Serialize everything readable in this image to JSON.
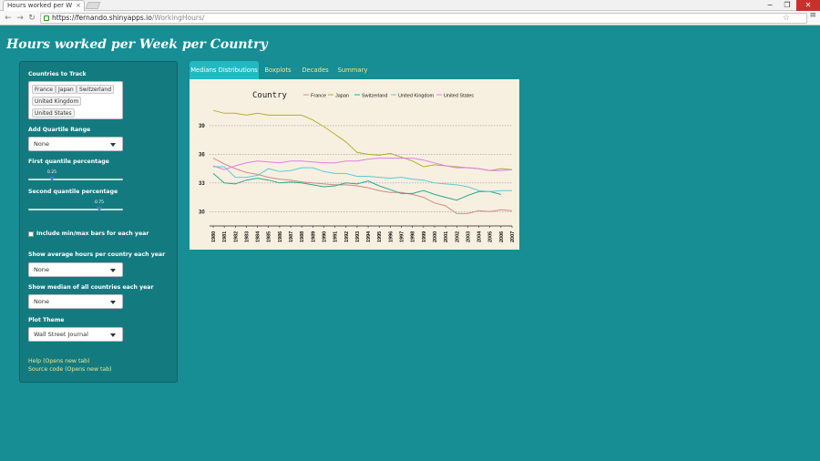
{
  "browser": {
    "tab_title": "Hours worked per W",
    "tab_close": "×",
    "url_host": "https://fernando.shinyapps.io",
    "url_path": "/WorkingHours/",
    "back_glyph": "←",
    "forward_glyph": "→",
    "reload_glyph": "↻",
    "star_glyph": "☆",
    "menu_glyph": "≡",
    "min_glyph": "−",
    "max_glyph": "❐",
    "close_glyph": "✕"
  },
  "app": {
    "title": "Hours worked per Week per Country"
  },
  "sidebar": {
    "countries_label": "Countries to Track",
    "countries": [
      "France",
      "Japan",
      "Switzerland",
      "United Kingdom",
      "United States"
    ],
    "quartile_label": "Add Quartile Range",
    "quartile_value": "None",
    "first_quartile_label": "First quantile percentage",
    "first_quartile_value": 0.25,
    "first_quartile_text": "0.25",
    "second_quartile_label": "Second quantile percentage",
    "second_quartile_value": 0.75,
    "second_quartile_text": "0.75",
    "minmax_label": "Include min/max bars for each year",
    "minmax_checked": false,
    "average_label": "Show average hours per country each year",
    "average_value": "None",
    "median_label": "Show median of all countries each year",
    "median_value": "None",
    "theme_label": "Plot Theme",
    "theme_value": "Wall Street Journal",
    "help_link": "Help (Opens new tab)",
    "source_link": "Source code (Opens new tab)"
  },
  "tabs": [
    {
      "label": "Medians Distributions",
      "active": true
    },
    {
      "label": "Boxplots",
      "active": false
    },
    {
      "label": "Decades",
      "active": false
    },
    {
      "label": "Summary",
      "active": false
    }
  ],
  "chart_data": {
    "type": "line",
    "legend_title": "Country",
    "legend_position": "top",
    "grid": true,
    "ylim": [
      28.5,
      41
    ],
    "yticks": [
      30,
      33,
      36,
      39
    ],
    "ytick_labels": [
      "30",
      "33",
      "36",
      "39"
    ],
    "x": [
      1980,
      1981,
      1982,
      1983,
      1984,
      1985,
      1986,
      1987,
      1988,
      1989,
      1990,
      1991,
      1992,
      1993,
      1994,
      1995,
      1996,
      1997,
      1998,
      1999,
      2000,
      2001,
      2002,
      2003,
      2004,
      2005,
      2006,
      2007
    ],
    "xtick_labels": [
      "1980",
      "1981",
      "1982",
      "1983",
      "1984",
      "1985",
      "1986",
      "1987",
      "1988",
      "1989",
      "1990",
      "1991",
      "1992",
      "1993",
      "1994",
      "1995",
      "1996",
      "1997",
      "1998",
      "1999",
      "2000",
      "2001",
      "2002",
      "2003",
      "2004",
      "2005",
      "2006",
      "2007"
    ],
    "series": [
      {
        "name": "France",
        "color": "#d08a86",
        "values": [
          35.6,
          35.0,
          34.5,
          34.1,
          33.9,
          33.6,
          33.4,
          33.3,
          33.1,
          33.0,
          32.9,
          32.8,
          32.8,
          32.7,
          32.5,
          32.2,
          32.0,
          32.0,
          31.8,
          31.5,
          30.9,
          30.6,
          29.8,
          29.8,
          30.1,
          30.0,
          30.2,
          30.1
        ]
      },
      {
        "name": "Japan",
        "color": "#b7ac2c",
        "values": [
          40.6,
          40.3,
          40.3,
          40.1,
          40.3,
          40.1,
          40.1,
          40.1,
          40.1,
          39.6,
          38.9,
          38.1,
          37.3,
          36.2,
          36.0,
          35.9,
          36.1,
          35.7,
          35.3,
          34.7,
          34.9,
          34.8,
          34.7,
          34.6,
          34.5,
          34.3,
          34.5,
          34.4
        ]
      },
      {
        "name": "Switzerland",
        "color": "#2ba98f",
        "values": [
          34.0,
          33.0,
          32.9,
          33.3,
          33.5,
          33.3,
          33.0,
          33.1,
          33.0,
          32.8,
          32.6,
          32.7,
          33.0,
          32.9,
          33.2,
          32.7,
          32.3,
          31.9,
          31.9,
          32.2,
          31.8,
          31.5,
          31.2,
          31.7,
          32.1,
          32.1,
          31.8,
          null
        ]
      },
      {
        "name": "United Kingdom",
        "color": "#5ec9d6",
        "values": [
          34.7,
          34.7,
          33.6,
          33.6,
          33.8,
          34.5,
          34.2,
          34.3,
          34.6,
          34.6,
          34.2,
          34.0,
          34.0,
          33.7,
          33.7,
          33.6,
          33.5,
          33.6,
          33.4,
          33.3,
          33.0,
          32.9,
          32.8,
          32.6,
          32.2,
          32.1,
          32.2,
          32.2
        ]
      },
      {
        "name": "United States",
        "color": "#e07ee8",
        "values": [
          34.8,
          34.4,
          34.8,
          35.1,
          35.3,
          35.2,
          35.1,
          35.3,
          35.3,
          35.2,
          35.1,
          35.1,
          35.3,
          35.3,
          35.5,
          35.6,
          35.6,
          35.6,
          35.6,
          35.4,
          35.1,
          34.8,
          34.6,
          34.6,
          34.5,
          34.3,
          34.3,
          34.4
        ]
      }
    ]
  }
}
